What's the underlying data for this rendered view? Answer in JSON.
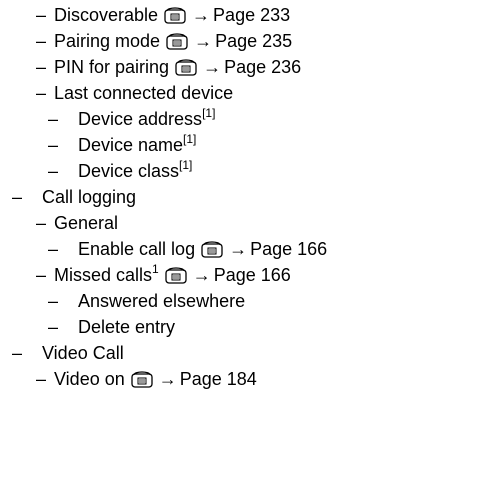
{
  "items": [
    {
      "dash": "–",
      "text": "Discoverable",
      "sup": "",
      "icon": "phone-icon",
      "arrow": "→",
      "page": "Page 233"
    },
    {
      "dash": "–",
      "text": "Pairing mode",
      "sup": "",
      "icon": "phone-icon",
      "arrow": "→",
      "page": "Page 235"
    },
    {
      "dash": "–",
      "text": "PIN for pairing",
      "sup": "",
      "icon": "phone-icon",
      "arrow": "→",
      "page": "Page 236"
    },
    {
      "dash": "–",
      "text": "Last connected device",
      "sup": "",
      "icon": "",
      "arrow": "",
      "page": ""
    },
    {
      "dash": "–",
      "text": "Device address",
      "sup": "[1]",
      "icon": "",
      "arrow": "",
      "page": ""
    },
    {
      "dash": "–",
      "text": "Device name",
      "sup": "[1]",
      "icon": "",
      "arrow": "",
      "page": ""
    },
    {
      "dash": "–",
      "text": "Device class",
      "sup": "[1]",
      "icon": "",
      "arrow": "",
      "page": ""
    },
    {
      "dash": "–",
      "text": "Call logging",
      "sup": "",
      "icon": "",
      "arrow": "",
      "page": ""
    },
    {
      "dash": "–",
      "text": "General",
      "sup": "",
      "icon": "",
      "arrow": "",
      "page": ""
    },
    {
      "dash": "–",
      "text": "Enable call log",
      "sup": "",
      "icon": "phone-icon",
      "arrow": "→",
      "page": "Page 166"
    },
    {
      "dash": "–",
      "text": "Missed calls",
      "sup": "1",
      "icon": "phone-icon",
      "arrow": "→",
      "page": "Page 166"
    },
    {
      "dash": "–",
      "text": "Answered elsewhere",
      "sup": "",
      "icon": "",
      "arrow": "",
      "page": ""
    },
    {
      "dash": "–",
      "text": "Delete entry",
      "sup": "",
      "icon": "",
      "arrow": "",
      "page": ""
    },
    {
      "dash": "–",
      "text": "Video Call",
      "sup": "",
      "icon": "",
      "arrow": "",
      "page": ""
    },
    {
      "dash": "–",
      "text": "Video on",
      "sup": "",
      "icon": "phone-icon",
      "arrow": "→",
      "page": "Page 184"
    }
  ]
}
